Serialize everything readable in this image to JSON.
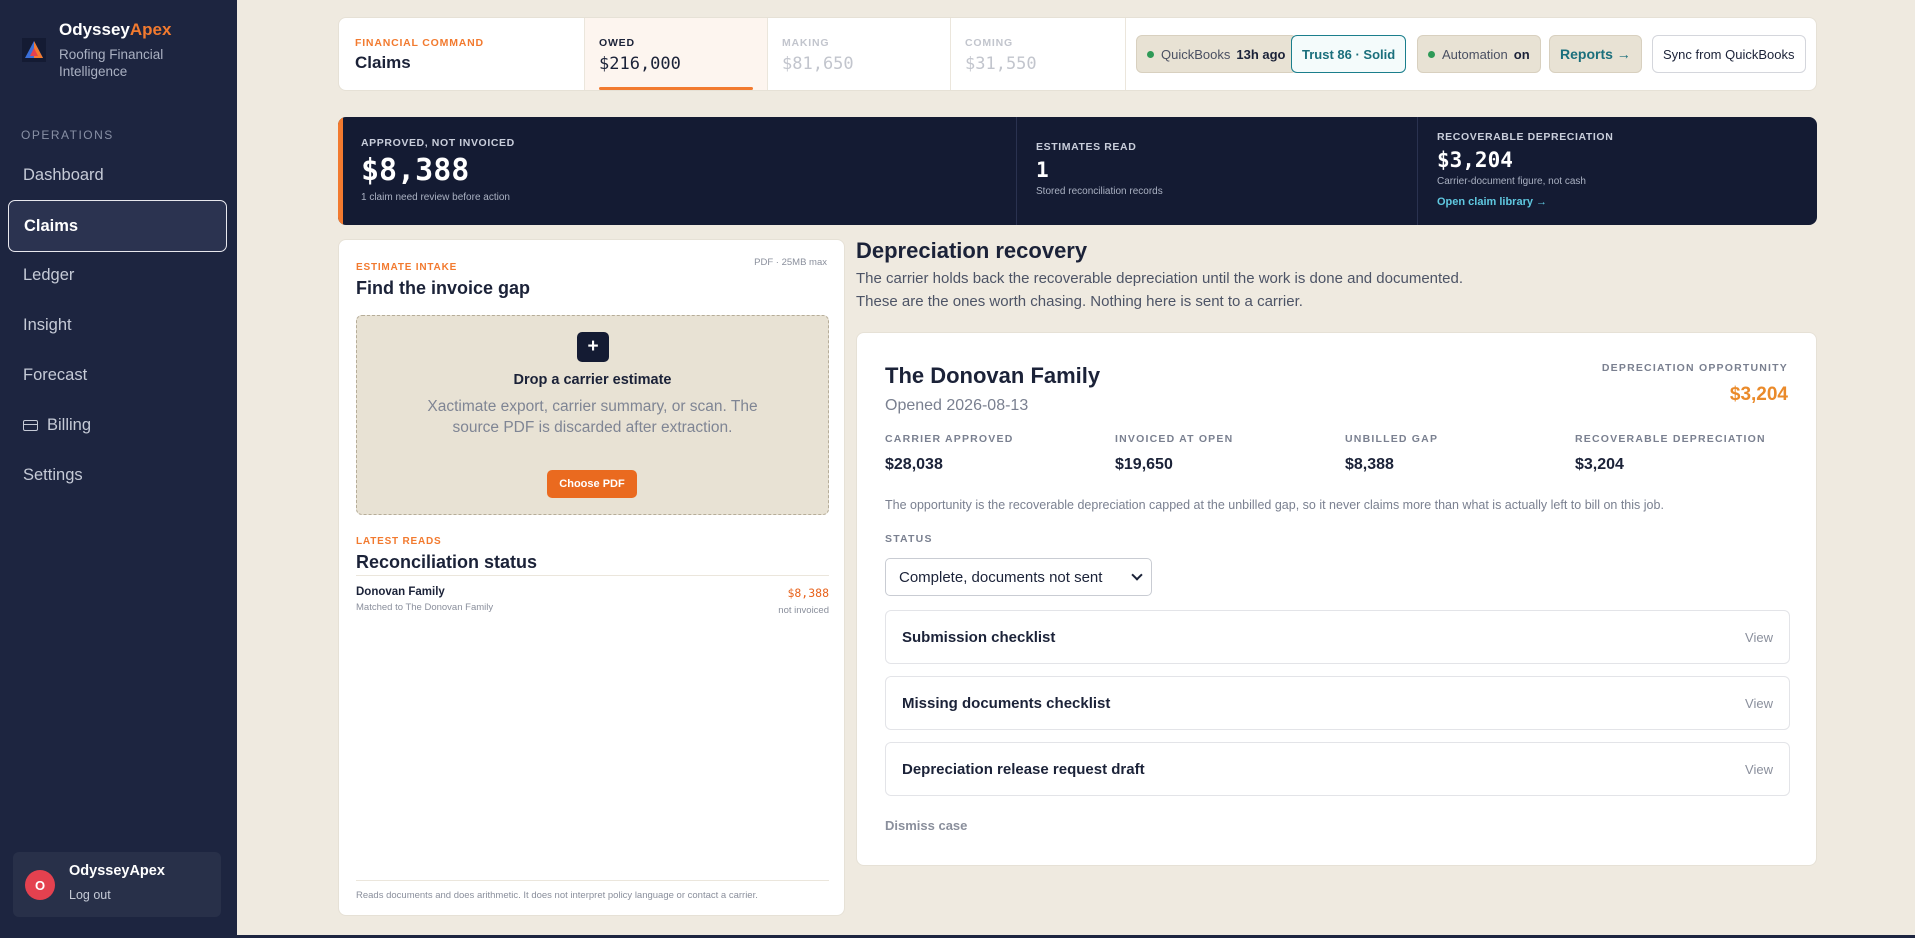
{
  "brand": {
    "name_part1": "Odyssey",
    "name_part2": "Apex",
    "subtitle": "Roofing Financial Intelligence"
  },
  "sidebar": {
    "section_label": "OPERATIONS",
    "items": [
      {
        "label": "Dashboard"
      },
      {
        "label": "Claims"
      },
      {
        "label": "Ledger"
      },
      {
        "label": "Insight"
      },
      {
        "label": "Forecast"
      },
      {
        "label": "Billing"
      },
      {
        "label": "Settings"
      }
    ],
    "active_item": "Claims",
    "user": {
      "initial": "O",
      "name": "OdysseyApex",
      "logout": "Log out"
    }
  },
  "topbar": {
    "eyebrow": "FINANCIAL COMMAND",
    "title": "Claims",
    "metrics": [
      {
        "label": "OWED",
        "value": "$216,000"
      },
      {
        "label": "MAKING",
        "value": "$81,650"
      },
      {
        "label": "COMING",
        "value": "$31,550"
      }
    ],
    "quickbooks": {
      "label": "QuickBooks",
      "age": "13h ago"
    },
    "trust": "Trust 86 · Solid",
    "automation": {
      "label": "Automation",
      "state": "on"
    },
    "reports": "Reports →",
    "sync": "Sync from QuickBooks"
  },
  "band": {
    "approved": {
      "label": "APPROVED, NOT INVOICED",
      "value": "$8,388",
      "sub": "1 claim need review before action"
    },
    "estimates": {
      "label": "ESTIMATES READ",
      "value": "1",
      "sub": "Stored reconciliation records"
    },
    "recoverable": {
      "label": "RECOVERABLE DEPRECIATION",
      "value": "$3,204",
      "sub": "Carrier-document figure, not cash",
      "link": "Open claim library →"
    }
  },
  "intake": {
    "meta": "PDF · 25MB max",
    "eyebrow": "ESTIMATE INTAKE",
    "title": "Find the invoice gap",
    "plus": "+",
    "drop_title": "Drop a carrier estimate",
    "drop_text": "Xactimate export, carrier summary, or scan. The source PDF is discarded after extraction.",
    "button": "Choose PDF",
    "reads_eyebrow": "LATEST READS",
    "reads_title": "Reconciliation status",
    "row": {
      "name": "Donovan Family",
      "amount": "$8,388",
      "matched": "Matched to The Donovan Family",
      "state": "not invoiced"
    },
    "footer": "Reads documents and does arithmetic. It does not interpret policy language or contact a carrier."
  },
  "depreciation": {
    "title": "Depreciation recovery",
    "desc_line1": "The carrier holds back the recoverable depreciation until the work is done and documented.",
    "desc_line2": "These are the ones worth chasing. Nothing here is sent to a carrier.",
    "case": {
      "name": "The Donovan Family",
      "opened": "Opened 2026-08-13",
      "opp_label": "DEPRECIATION OPPORTUNITY",
      "opp_value": "$3,204",
      "fields": [
        {
          "label": "CARRIER APPROVED",
          "value": "$28,038"
        },
        {
          "label": "INVOICED AT OPEN",
          "value": "$19,650"
        },
        {
          "label": "UNBILLED GAP",
          "value": "$8,388"
        },
        {
          "label": "RECOVERABLE DEPRECIATION",
          "value": "$3,204"
        }
      ],
      "note": "The opportunity is the recoverable depreciation capped at the unbilled gap, so it never claims more than what is actually left to bill on this job.",
      "status_label": "STATUS",
      "status_value": "Complete, documents not sent",
      "checklists": [
        {
          "title": "Submission checklist",
          "action": "View"
        },
        {
          "title": "Missing documents checklist",
          "action": "View"
        },
        {
          "title": "Depreciation release request draft",
          "action": "View"
        }
      ],
      "dismiss": "Dismiss case"
    }
  },
  "colors": {
    "accent": "#f27a2f",
    "navy": "#141b33",
    "sidebar": "#1d2540",
    "teal": "#1a7e8c",
    "background": "#efeae0"
  }
}
